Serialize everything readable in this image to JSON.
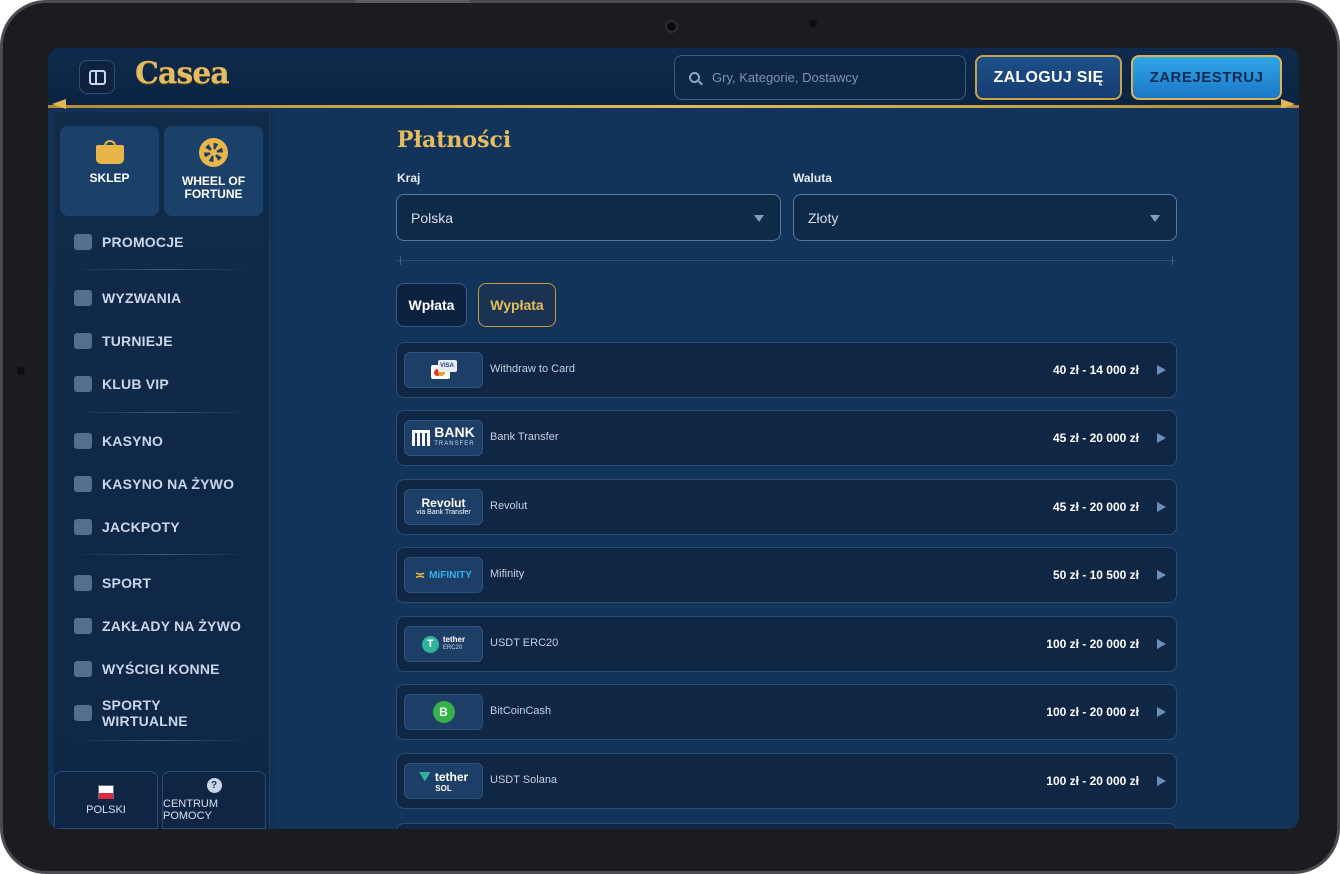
{
  "header": {
    "brand": "Casea",
    "search_placeholder": "Gry, Kategorie, Dostawcy",
    "login_label": "ZALOGUJ SIĘ",
    "register_label": "ZAREJESTRUJ"
  },
  "sidebar": {
    "tiles": [
      {
        "label": "SKLEP",
        "icon": "bag-icon"
      },
      {
        "label": "WHEEL OF FORTUNE",
        "icon": "wheel-icon"
      }
    ],
    "items": [
      {
        "label": "PROMOCJE",
        "icon": "gift-icon"
      },
      {
        "label": "WYZWANIA",
        "icon": "badge-icon"
      },
      {
        "label": "TURNIEJE",
        "icon": "trophy-icon"
      },
      {
        "label": "KLUB VIP",
        "icon": "diamond-icon"
      },
      {
        "label": "KASYNO",
        "icon": "slot-machine-icon"
      },
      {
        "label": "KASYNO NA ŻYWO",
        "icon": "card-icon"
      },
      {
        "label": "JACKPOTY",
        "icon": "clover-icon"
      },
      {
        "label": "SPORT",
        "icon": "ball-icon"
      },
      {
        "label": "ZAKŁADY NA ŻYWO",
        "icon": "live-icon"
      },
      {
        "label": "WYŚCIGI KONNE",
        "icon": "horse-icon"
      },
      {
        "label": "SPORTY WIRTUALNE",
        "icon": "monitor-icon"
      }
    ],
    "language_label": "POLSKI",
    "help_label": "CENTRUM POMOCY"
  },
  "main": {
    "title": "Płatności",
    "country_label": "Kraj",
    "country_value": "Polska",
    "currency_label": "Waluta",
    "currency_value": "Złoty",
    "tabs": [
      {
        "label": "Wpłata"
      },
      {
        "label": "Wypłata",
        "active": true
      }
    ],
    "methods": [
      {
        "name": "Withdraw to Card",
        "limits": "40 zł - 14 000 zł",
        "logo": "card-logo",
        "logo_text": "VISA"
      },
      {
        "name": "Bank Transfer",
        "limits": "45 zł - 20 000 zł",
        "logo": "bank-transfer-logo",
        "logo_text": "BANK",
        "logo_sub": "TRANSFER"
      },
      {
        "name": "Revolut",
        "limits": "45 zł - 20 000 zł",
        "logo": "revolut-logo",
        "logo_text": "Revolut",
        "logo_sub": "via Bank Transfer"
      },
      {
        "name": "Mifinity",
        "limits": "50 zł - 10 500 zł",
        "logo": "mifinity-logo",
        "logo_text": "MiFINITY"
      },
      {
        "name": "USDT ERC20",
        "limits": "100 zł - 20 000 zł",
        "logo": "tether-logo",
        "logo_text": "tether",
        "logo_sub": "ERC20"
      },
      {
        "name": "BitCoinCash",
        "limits": "100 zł - 20 000 zł",
        "logo": "bitcoin-cash-logo"
      },
      {
        "name": "USDT Solana",
        "limits": "100 zł - 20 000 zł",
        "logo": "tether-logo",
        "logo_text": "tether",
        "logo_sub": "SOL"
      }
    ]
  },
  "colors": {
    "gold": "#e6bd5e",
    "background": "#13345a",
    "accent_blue": "#2fa6e8"
  }
}
